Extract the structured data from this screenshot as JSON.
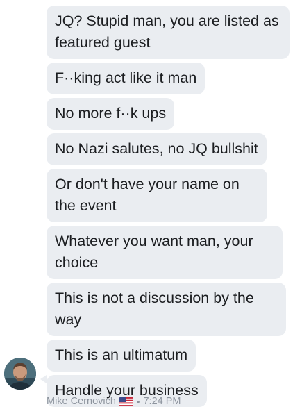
{
  "messages": [
    "JQ? Stupid man, you are listed as featured guest",
    "F··king act like it man",
    "No more f··k ups",
    "No Nazi salutes, no JQ bullshit",
    "Or don't have your name on the event",
    "Whatever you want man, your choice",
    "This is not a discussion by the way",
    "This is an ultimatum",
    "Handle your business"
  ],
  "sender": {
    "name": "Mike Cernovich",
    "flag_icon": "us-flag-icon",
    "separator": "•",
    "time": "7:24 PM"
  },
  "colors": {
    "bubble_bg": "#eaedf1",
    "text": "#1c1e21",
    "meta_text": "#8d949e"
  }
}
